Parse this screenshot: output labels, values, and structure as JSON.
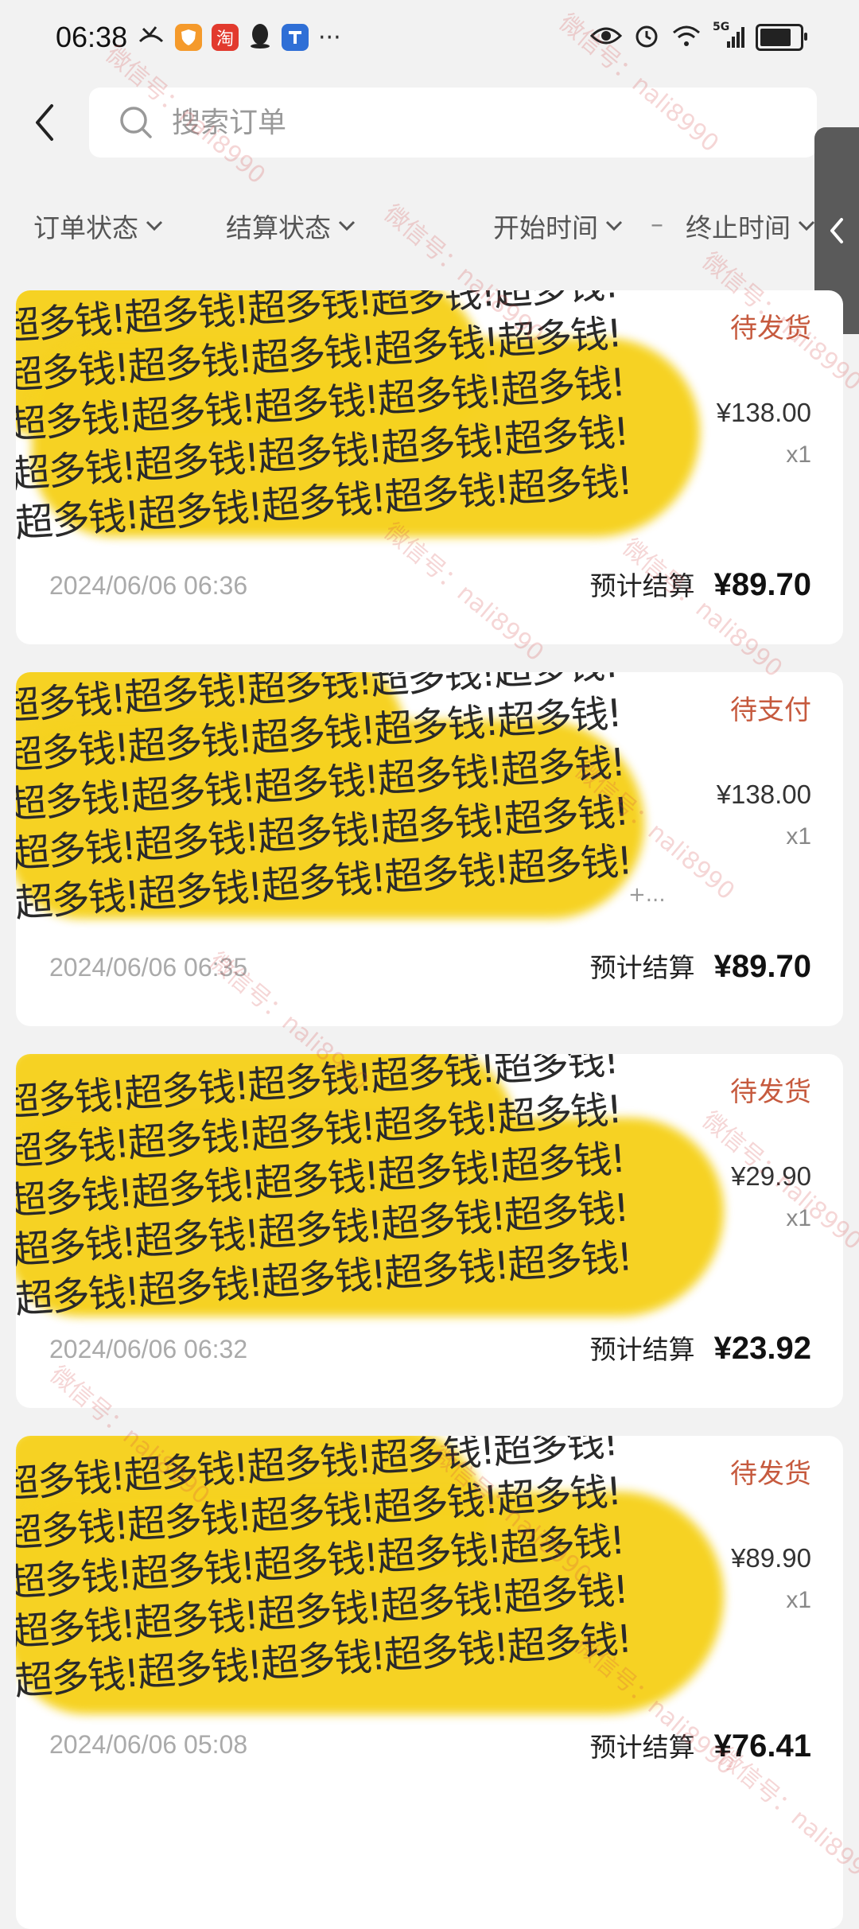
{
  "status_bar": {
    "time": "06:38",
    "left_icons": [
      "missed-call-icon",
      "shield-app-icon",
      "taobao-app-icon",
      "qq-app-icon",
      "app-icon"
    ],
    "taobao_glyph": "淘",
    "more": "···",
    "network": "5G",
    "battery_level": 0.9
  },
  "header": {
    "search_placeholder": "搜索订单"
  },
  "filters": {
    "order_status": "订单状态",
    "settlement_status": "结算状态",
    "start_time": "开始时间",
    "separator": "–",
    "end_time": "终止时间"
  },
  "redaction_text": "超多钱!超多钱!超多钱!超多钱!超多钱!",
  "watermark_text": "微信号：nali8990",
  "orders": [
    {
      "status": "待发货",
      "price": "¥138.00",
      "qty": "x1",
      "time": "2024/06/06 06:36",
      "settle_label": "预计结算",
      "settle_amount": "¥89.70"
    },
    {
      "status": "待支付",
      "price": "¥138.00",
      "qty": "x1",
      "time": "2024/06/06 06:35",
      "settle_label": "预计结算",
      "settle_amount": "¥89.70",
      "more": "+..."
    },
    {
      "status": "待发货",
      "price": "¥29.90",
      "qty": "x1",
      "time": "2024/06/06 06:32",
      "settle_label": "预计结算",
      "settle_amount": "¥23.92"
    },
    {
      "status": "待发货",
      "price": "¥89.90",
      "qty": "x1",
      "time": "2024/06/06 05:08",
      "settle_label": "预计结算",
      "settle_amount": "¥76.41"
    }
  ],
  "colors": {
    "status_accent": "#c65a3e",
    "redaction": "#f6d21f",
    "background": "#f2f2f2"
  }
}
